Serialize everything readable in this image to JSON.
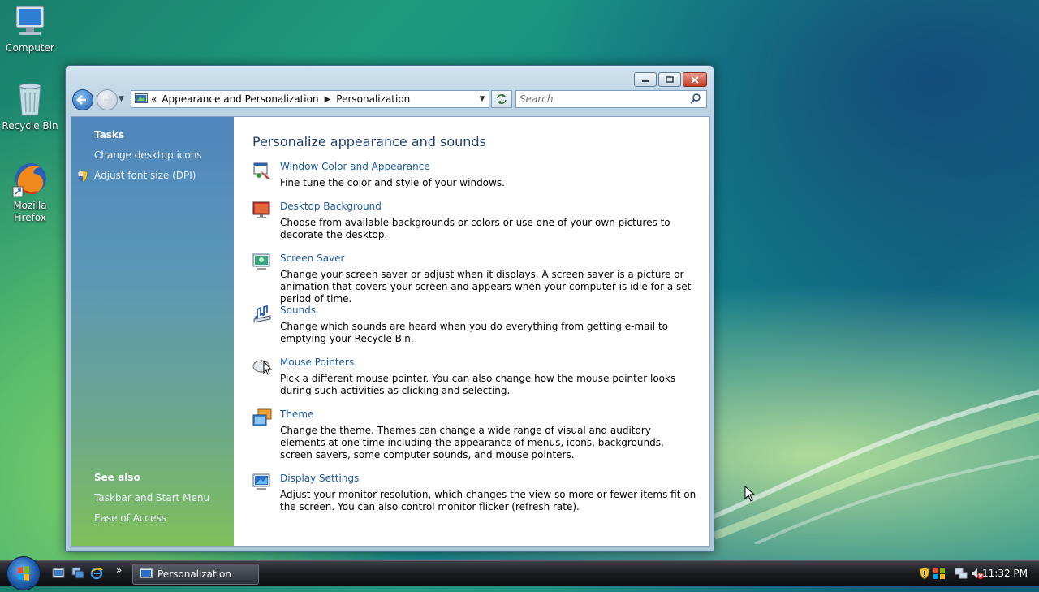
{
  "desktop": {
    "icons": [
      {
        "label": "Computer"
      },
      {
        "label": "Recycle Bin"
      },
      {
        "label": "Mozilla Firefox"
      }
    ]
  },
  "window": {
    "breadcrumb_overflow": "«",
    "breadcrumb": [
      "Appearance and Personalization",
      "Personalization"
    ],
    "search_placeholder": "Search",
    "left": {
      "tasks_heading": "Tasks",
      "tasks": [
        "Change desktop icons",
        "Adjust font size (DPI)"
      ],
      "see_also_heading": "See also",
      "see_also": [
        "Taskbar and Start Menu",
        "Ease of Access"
      ]
    },
    "main": {
      "heading": "Personalize appearance and sounds",
      "items": [
        {
          "title": "Window Color and Appearance",
          "desc": "Fine tune the color and style of your windows."
        },
        {
          "title": "Desktop Background",
          "desc": "Choose from available backgrounds or colors or use one of your own pictures to decorate the desktop."
        },
        {
          "title": "Screen Saver",
          "desc": "Change your screen saver or adjust when it displays. A screen saver is a picture or animation that covers your screen and appears when your computer is idle for a set period of time."
        },
        {
          "title": "Sounds",
          "desc": "Change which sounds are heard when you do everything from getting e-mail to emptying your Recycle Bin."
        },
        {
          "title": "Mouse Pointers",
          "desc": "Pick a different mouse pointer. You can also change how the mouse pointer looks during such activities as clicking and selecting."
        },
        {
          "title": "Theme",
          "desc": "Change the theme. Themes can change a wide range of visual and auditory elements at one time including the appearance of menus, icons, backgrounds, screen savers, some computer sounds, and mouse pointers."
        },
        {
          "title": "Display Settings",
          "desc": "Adjust your monitor resolution, which changes the view so more or fewer items fit on the screen. You can also control monitor flicker (refresh rate)."
        }
      ]
    }
  },
  "taskbar": {
    "overflow": "»",
    "active_task": "Personalization",
    "clock": "11:32 PM"
  },
  "colors": {
    "link": "#1c5aa6",
    "heading": "#1e3d6b",
    "left_pane_top": "#4f86bd",
    "left_pane_bottom": "#7fbf5a"
  }
}
